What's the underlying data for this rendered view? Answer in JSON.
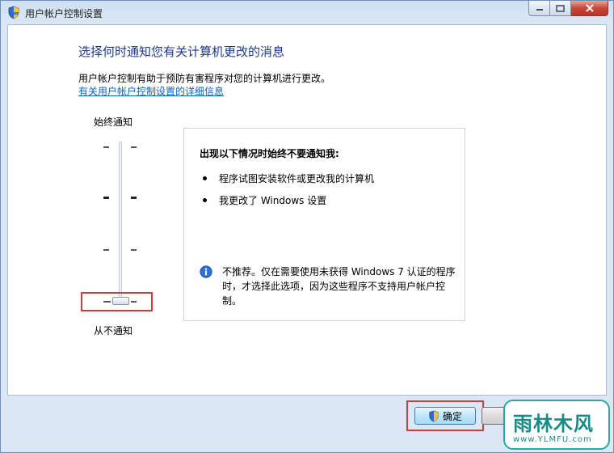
{
  "window": {
    "title": "用户帐户控制设置"
  },
  "header": {
    "heading": "选择何时通知您有关计算机更改的消息",
    "description": "用户帐户控制有助于预防有害程序对您的计算机进行更改。",
    "link": "有关用户帐户控制设置的详细信息"
  },
  "slider": {
    "top_label": "始终通知",
    "bottom_label": "从不通知",
    "levels": 4,
    "selected_level": 1
  },
  "info": {
    "title": "出现以下情况时始终不要通知我:",
    "bullets": [
      "程序试图安装软件或更改我的计算机",
      "我更改了 Windows 设置"
    ],
    "note": "不推荐。仅在需要使用未获得 Windows 7 认证的程序时，才选择此选项，因为这些程序不支持用户帐户控制。"
  },
  "buttons": {
    "ok": "确定"
  },
  "watermark": {
    "main": "雨林木风",
    "sub": "www.YLMFU.com"
  },
  "colors": {
    "heading": "#1e3a8a",
    "link": "#0066cc",
    "highlight": "#d03b3b",
    "watermark": "#1a8c88"
  }
}
